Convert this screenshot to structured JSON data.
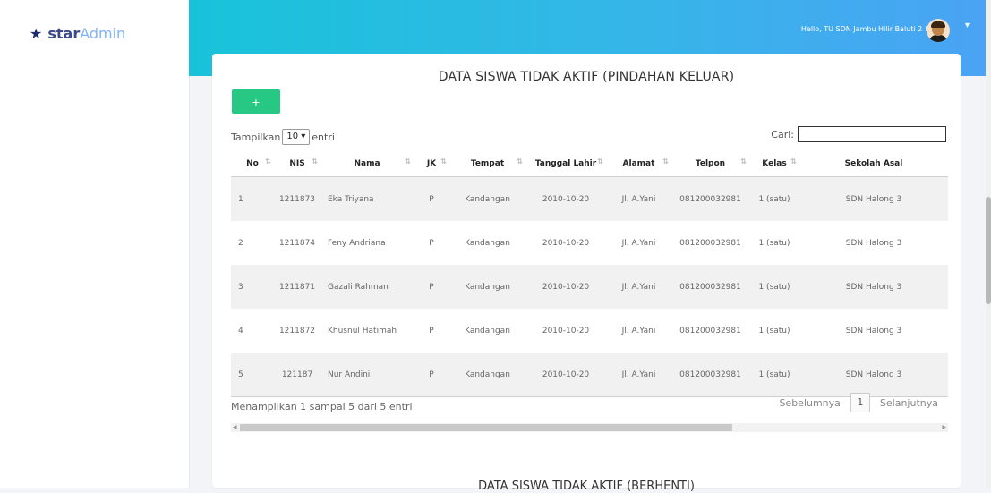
{
  "brand": {
    "icon": "star-icon",
    "name_bold": "star",
    "name_light": "Admin"
  },
  "header": {
    "greeting": "Hello, TU SDN Jambu Hilir Baluti 2 !",
    "caret": "▾",
    "colors": {
      "gradient_start": "#18c3d9",
      "gradient_end": "#4aa3f4"
    }
  },
  "section1": {
    "title": "DATA SISWA TIDAK AKTIF (PINDAHAN KELUAR)",
    "add_button_label": "+",
    "length": {
      "prefix": "Tampilkan",
      "selected": "10 ▾",
      "suffix": "entri"
    },
    "search": {
      "label": "Cari:",
      "value": ""
    },
    "table": {
      "columns": [
        "No",
        "NIS",
        "Nama",
        "JK",
        "Tempat",
        "Tanggal Lahir",
        "Alamat",
        "Telpon",
        "Kelas",
        "Sekolah Asal"
      ],
      "rows": [
        [
          "1",
          "1211873",
          "Eka Triyana",
          "P",
          "Kandangan",
          "2010-10-20",
          "Jl. A.Yani",
          "081200032981",
          "1 (satu)",
          "SDN Halong 3"
        ],
        [
          "2",
          "1211874",
          "Feny Andriana",
          "P",
          "Kandangan",
          "2010-10-20",
          "Jl. A.Yani",
          "081200032981",
          "1 (satu)",
          "SDN Halong 3"
        ],
        [
          "3",
          "1211871",
          "Gazali Rahman",
          "P",
          "Kandangan",
          "2010-10-20",
          "Jl. A.Yani",
          "081200032981",
          "1 (satu)",
          "SDN Halong 3"
        ],
        [
          "4",
          "1211872",
          "Khusnul Hatimah",
          "P",
          "Kandangan",
          "2010-10-20",
          "Jl. A.Yani",
          "081200032981",
          "1 (satu)",
          "SDN Halong 3"
        ],
        [
          "5",
          "121187",
          "Nur Andini",
          "P",
          "Kandangan",
          "2010-10-20",
          "Jl. A.Yani",
          "081200032981",
          "1 (satu)",
          "SDN Halong 3"
        ]
      ]
    },
    "info": "Menampilkan 1 sampai 5 dari 5 entri",
    "pagination": {
      "prev": "Sebelumnya",
      "page": "1",
      "next": "Selanjutnya"
    }
  },
  "section2": {
    "title": "DATA SISWA TIDAK AKTIF (BERHENTI)"
  }
}
